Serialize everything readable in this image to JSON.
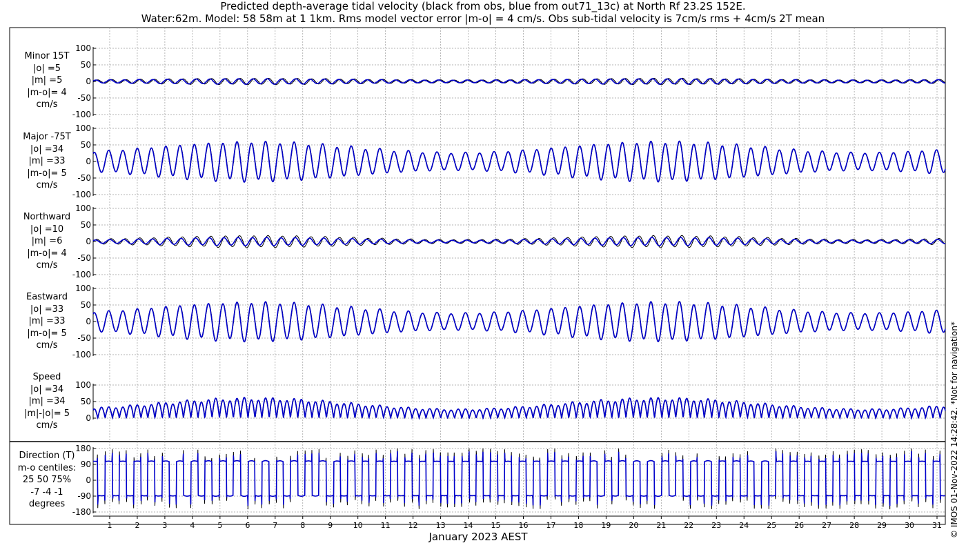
{
  "title": {
    "line1": "Predicted depth-average tidal velocity (black from obs, blue from out71_13c) at North Rf 23.2S 152E.",
    "line2": "Water:62m. Model: 58 58m at 1 1km. Rms model vector error |m-o| = 4 cm/s. Obs sub-tidal velocity is 7cm/s rms + 4cm/s 2T mean"
  },
  "xlabel": "January 2023 AEST",
  "credit": "© IMOS 01-Nov-2022 14:28:42. *Not for navigation*",
  "colors": {
    "obs": "#000000",
    "model": "#0000cc",
    "grid": "#9a9a9a"
  },
  "chart_data": {
    "type": "line",
    "x_ticks": [
      "1",
      "2",
      "3",
      "4",
      "5",
      "6",
      "7",
      "8",
      "9",
      "10",
      "11",
      "12",
      "13",
      "14",
      "15",
      "16",
      "17",
      "18",
      "19",
      "20",
      "21",
      "22",
      "23",
      "24",
      "25",
      "26",
      "27",
      "28",
      "29",
      "30",
      "31"
    ],
    "xlim": [
      0.4,
      31.3
    ],
    "series_names": [
      "obs",
      "model"
    ],
    "grid": true,
    "panels": [
      {
        "name": "minor",
        "label_lines": [
          "Minor 15T",
          "|o| =5",
          "|m| =5",
          "|m-o|= 4",
          "cm/s"
        ],
        "ylim": [
          -100,
          100
        ],
        "yticks": [
          "100",
          "50",
          "0",
          "-50",
          "-100"
        ],
        "amplitude": 6,
        "spring": 2,
        "m2_phase": 0.2,
        "offset": 0,
        "obs_amp_factor": 1.15,
        "obs_lag": 0.06
      },
      {
        "name": "major",
        "label_lines": [
          "Major -75T",
          "|o| =34",
          "|m| =33",
          "|m-o|= 5",
          "cm/s"
        ],
        "ylim": [
          -100,
          100
        ],
        "yticks": [
          "100",
          "50",
          "0",
          "-50",
          "-100"
        ],
        "amplitude": 42,
        "spring": 16,
        "m2_phase": 0.9,
        "offset": 0,
        "obs_amp_factor": 1.0,
        "obs_lag": 0.01
      },
      {
        "name": "northward",
        "label_lines": [
          "Northward",
          "|o| =10",
          "|m| =6",
          "|m-o|= 4",
          "cm/s"
        ],
        "ylim": [
          -100,
          100
        ],
        "yticks": [
          "100",
          "50",
          "0",
          "-50",
          "-100"
        ],
        "amplitude": 8,
        "spring": 4,
        "m2_phase": 0.4,
        "offset": 0,
        "obs_amp_factor": 1.45,
        "obs_lag": 0.05
      },
      {
        "name": "eastward",
        "label_lines": [
          "Eastward",
          "|o| =33",
          "|m| =33",
          "|m-o|= 5",
          "cm/s"
        ],
        "ylim": [
          -100,
          100
        ],
        "yticks": [
          "100",
          "50",
          "0",
          "-50",
          "-100"
        ],
        "amplitude": 41,
        "spring": 16,
        "m2_phase": 0.9,
        "offset": 0,
        "obs_amp_factor": 1.0,
        "obs_lag": 0.01
      },
      {
        "name": "speed",
        "label_lines": [
          "Speed",
          "|o| =34",
          "|m| =34",
          "|m|-|o|= 5",
          "cm/s"
        ],
        "ylim": [
          0,
          100
        ],
        "yticks": [
          "100",
          "50",
          "0"
        ],
        "amplitude": 42,
        "spring": 16,
        "m2_phase": 0.9,
        "offset": 0,
        "obs_amp_factor": 1.0,
        "obs_lag": 0.01,
        "kind": "speed"
      },
      {
        "name": "direction",
        "label_lines": [
          "Direction (T)",
          "m-o centiles:",
          "25  50  75%",
          "-7 -4 -1",
          "degrees"
        ],
        "ylim": [
          -180,
          180
        ],
        "yticks": [
          "180",
          "90",
          "0",
          "-90",
          "-180"
        ],
        "kind": "direction",
        "dir_high": 105,
        "dir_low": -85
      }
    ]
  }
}
